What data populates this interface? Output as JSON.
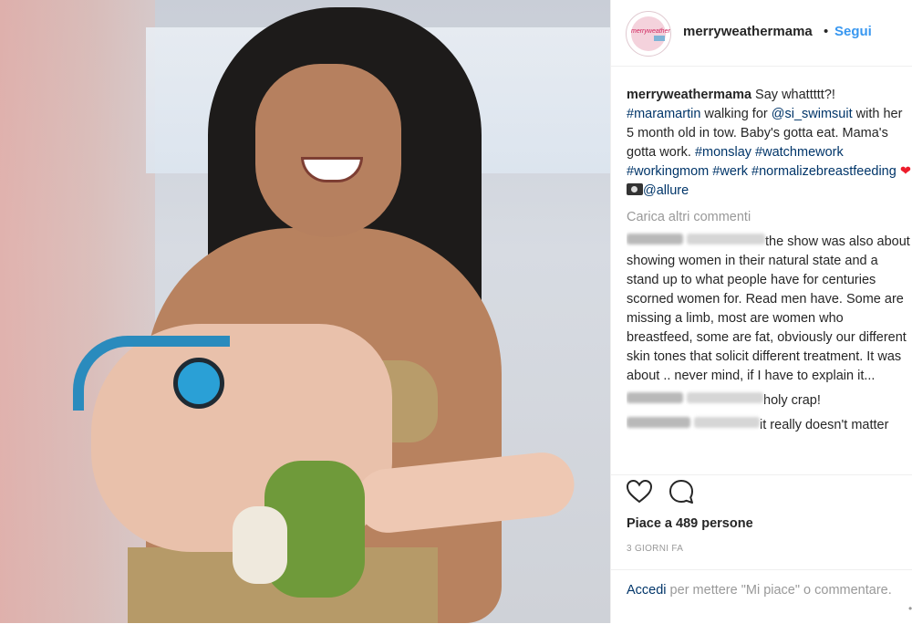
{
  "photo": {
    "alt": ""
  },
  "header": {
    "username": "merryweathermama",
    "separator": "•",
    "follow_label": "Segui",
    "avatar_logo_text": "merryweather"
  },
  "caption": {
    "username": "merryweathermama",
    "text_1": " Say whattttt?! ",
    "tag_1": "#maramartin",
    "text_2": " walking for ",
    "tag_2": "@si_swimsuit",
    "text_3": " with her 5 month old in tow. Baby's gotta eat. Mama's gotta work. ",
    "tag_3": "#monslay",
    "tag_4": "#watchmework",
    "tag_5": "#workingmom",
    "tag_6": "#werk",
    "tag_7": "#normalizebreastfeeding",
    "emoji_heart": "❤",
    "tag_8": "@allure"
  },
  "load_more": "Carica altri commenti",
  "comments": [
    {
      "text": "the show was also about showing women in their natural state and a stand up to what people have for centuries scorned women for. Read men have. Some are missing a limb, most are women who breastfeed, some are fat, obviously our different skin tones that solicit different treatment. It was about .. never mind, if I have to explain it..."
    },
    {
      "text": "holy crap!"
    },
    {
      "text": "it really doesn't matter"
    }
  ],
  "likes": "Piace a 489 persone",
  "time": "3 GIORNI FA",
  "login": {
    "link": "Accedi",
    "text": " per mettere \"Mi piace\" o commentare."
  },
  "scroll_marker": "•",
  "icons": {
    "like": "heart-outline-icon",
    "comment": "speech-bubble-icon",
    "camera": "camera-emoji-icon"
  }
}
